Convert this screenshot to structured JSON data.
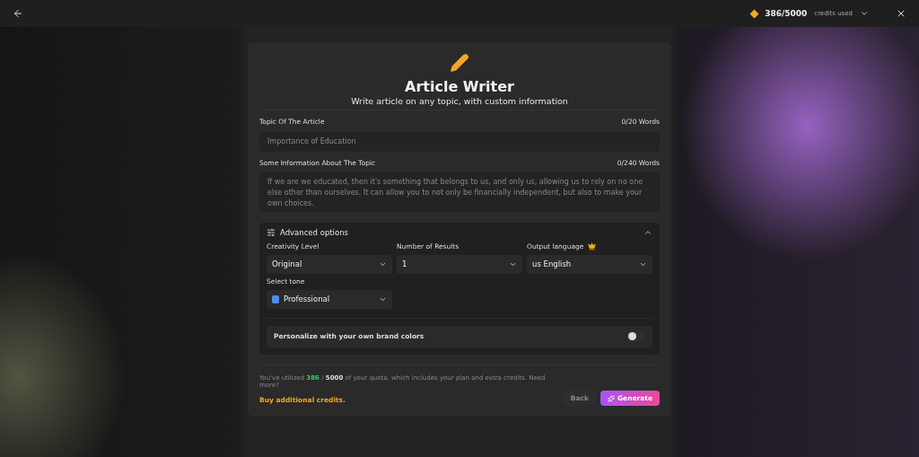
{
  "top_bar": {
    "credits": "386/5000",
    "credits_label": "credits used"
  },
  "header": {
    "title": "Article Writer",
    "subtitle": "Write article on any topic, with custom information"
  },
  "fields": [
    {
      "kind": "input",
      "label": "Topic Of The Article",
      "counter": "0/20 Words",
      "placeholder": "Importance of Education"
    },
    {
      "kind": "textarea",
      "label": "Some Information About The Topic",
      "counter": "0/240 Words",
      "placeholder": "If we are we educated, then it's something that belongs to us, and only us, allowing us to rely on no one else other than ourselves. It can allow you to not only be financially independent, but also to make your own choices."
    }
  ],
  "advanced": {
    "title": "Advanced options",
    "expanded": true,
    "selects": [
      {
        "label": "Creativity Level",
        "value": "Original",
        "premium": false,
        "has_icon": false
      },
      {
        "label": "Number of Results",
        "value": "1",
        "premium": false,
        "has_icon": false
      },
      {
        "label": "Output language",
        "value": "us English",
        "premium": true,
        "has_icon": false
      },
      {
        "label": "Select tone",
        "value": "Professional",
        "premium": false,
        "has_icon": true
      }
    ],
    "brand_colors": {
      "label": "Personalize with your own brand colors",
      "on": false
    }
  },
  "footer": {
    "quota": "You've utilized **386** / **5000** of your quota, which includes your plan and extra credits. Need more?",
    "link": "Buy additional credits.",
    "buttons": [
      {
        "label": "Back",
        "kind": "secondary",
        "disabled": true
      },
      {
        "label": "Generate",
        "kind": "primary",
        "disabled": false
      }
    ]
  }
}
